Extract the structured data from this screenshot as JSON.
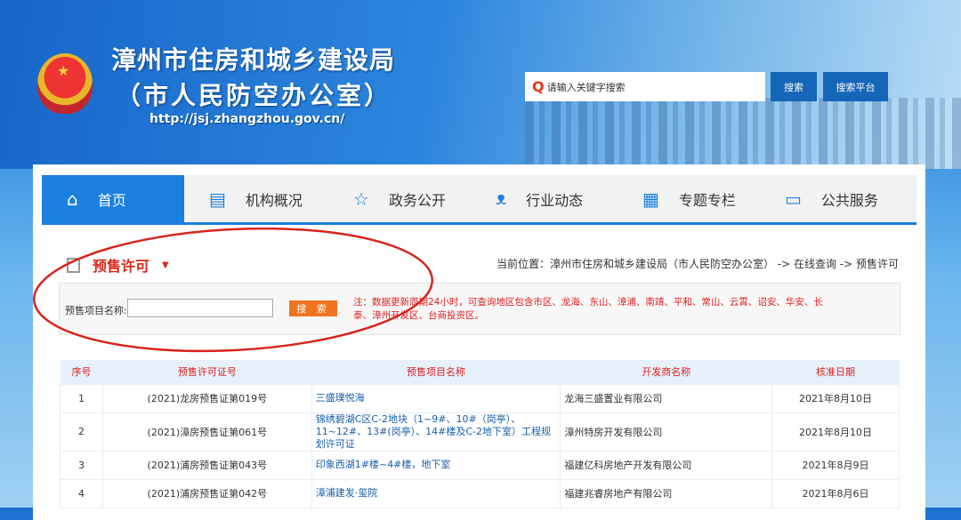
{
  "header": {
    "title_line1": "漳州市住房和城乡建设局",
    "title_line2": "（市人民防空办公室）",
    "url": "http://jsj.zhangzhou.gov.cn/",
    "search_placeholder": "请输入关键字搜索",
    "search_button": "搜索",
    "platform_button": "搜索平台"
  },
  "nav": [
    {
      "label": "首页",
      "icon": "⌂"
    },
    {
      "label": "机构概况",
      "icon": "▤"
    },
    {
      "label": "政务公开",
      "icon": "☆"
    },
    {
      "label": "行业动态",
      "icon": "ᴥ"
    },
    {
      "label": "专题专栏",
      "icon": "▦"
    },
    {
      "label": "公共服务",
      "icon": "▭"
    }
  ],
  "section": {
    "title": "预售许可",
    "breadcrumb": "当前位置：漳州市住房和城乡建设局（市人民防空办公室） -> 在线查询 -> 预售许可"
  },
  "form": {
    "label": "预售项目名称:",
    "value": "",
    "button": "搜 索",
    "note": "注：数据更新周期24小时，可查询地区包含市区、龙海、东山、漳浦、南靖、平和、常山、云霄、诏安、华安、长泰、漳州开发区、台商投资区。"
  },
  "table": {
    "headers": [
      "序号",
      "预售许可证号",
      "预售项目名称",
      "开发商名称",
      "核准日期"
    ],
    "rows": [
      [
        "1",
        "(2021)龙房预售证第019号",
        "三盛璞悦海",
        "龙海三盛置业有限公司",
        "2021年8月10日"
      ],
      [
        "2",
        "(2021)漳房预售证第061号",
        "锦绣碧湖C区C-2地块（1~9#、10#（岗亭）、11~12#、13#(岗亭）、14#楼及C-2地下室）工程规划许可证",
        "漳州特房开发有限公司",
        "2021年8月10日"
      ],
      [
        "3",
        "(2021)浦房预售证第043号",
        "印象西湖1#楼~4#楼，地下室",
        "福建亿科房地产开发有限公司",
        "2021年8月9日"
      ],
      [
        "4",
        "(2021)浦房预售证第042号",
        "漳浦建发·玺院",
        "福建兆睿房地产有限公司",
        "2021年8月6日"
      ]
    ]
  }
}
